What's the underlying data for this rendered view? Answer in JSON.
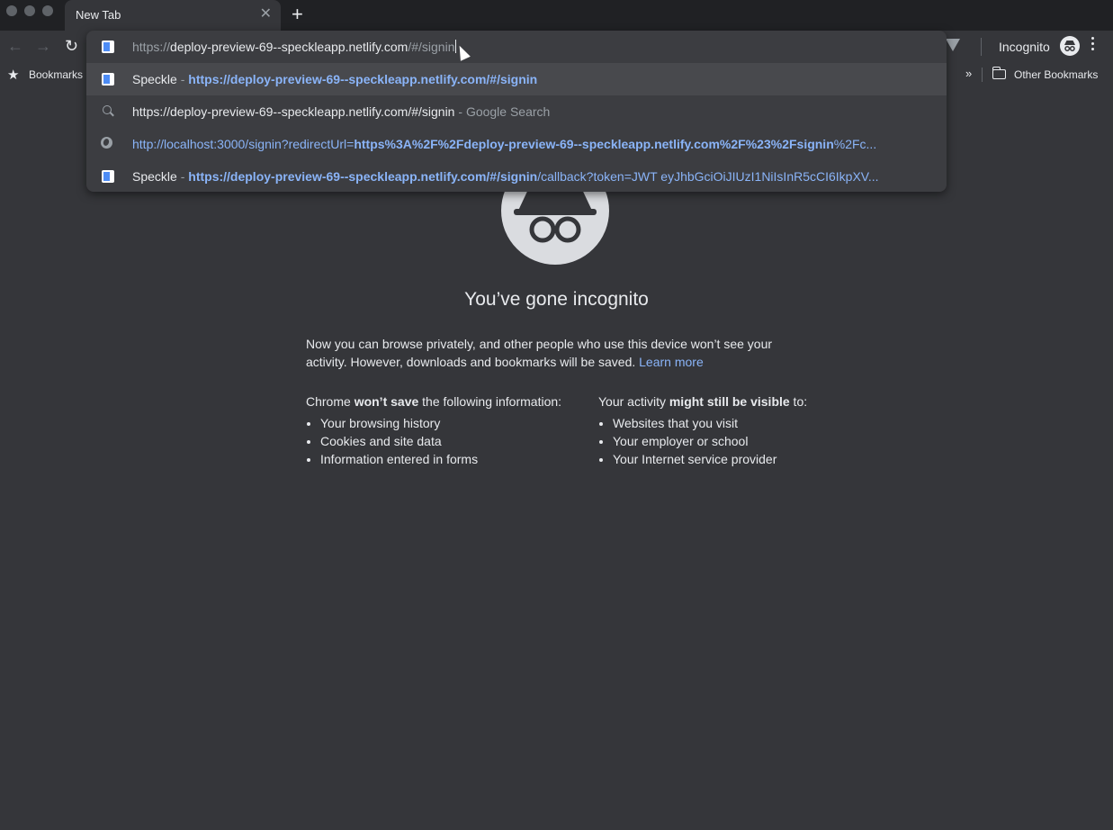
{
  "tab": {
    "title": "New Tab",
    "close_glyph": "✕",
    "new_tab_glyph": "+"
  },
  "toolbar": {
    "back_glyph": "←",
    "forward_glyph": "→",
    "reload_glyph": "↻",
    "profile_label": "Incognito"
  },
  "bookmarks_bar": {
    "label": "Bookmarks",
    "overflow_glyph": "»",
    "other_label": "Other Bookmarks"
  },
  "omnibox": {
    "input": {
      "scheme": "https://",
      "host": "deploy-preview-69--speckleapp.netlify.com",
      "path": "/#/signin"
    },
    "suggestions": [
      {
        "icon": "page-icon",
        "title": "Speckle",
        "separator": " - ",
        "url_bold": "https://deploy-preview-69--speckleapp.netlify.com/#/signin",
        "url_rest": ""
      },
      {
        "icon": "search-icon",
        "query": "https://deploy-preview-69--speckleapp.netlify.com/#/signin",
        "separator": " - ",
        "engine": "Google Search"
      },
      {
        "icon": "globe-icon",
        "url_pre": "http://localhost:3000/signin?redirectUrl=",
        "url_bold": "https%3A%2F%2Fdeploy-preview-69--speckleapp.netlify.com%2F%23%2Fsignin",
        "url_rest": "%2Fc..."
      },
      {
        "icon": "page-icon",
        "title": "Speckle",
        "separator": " - ",
        "url_bold": "https://deploy-preview-69--speckleapp.netlify.com/#/signin",
        "url_rest": "/callback?token=JWT eyJhbGciOiJIUzI1NiIsInR5cCI6IkpXV..."
      }
    ]
  },
  "incognito_page": {
    "title": "You’ve gone incognito",
    "intro_text": "Now you can browse privately, and other people who use this device won’t see your activity. However, downloads and bookmarks will be saved. ",
    "learn_more": "Learn more",
    "left_column": {
      "head_pre": "Chrome ",
      "head_bold": "won’t save",
      "head_post": " the following information:",
      "items": [
        "Your browsing history",
        "Cookies and site data",
        "Information entered in forms"
      ]
    },
    "right_column": {
      "head_pre": "Your activity ",
      "head_bold": "might still be visible",
      "head_post": " to:",
      "items": [
        "Websites that you visit",
        "Your employer or school",
        "Your Internet service provider"
      ]
    }
  },
  "colors": {
    "page_bg": "#35363a",
    "tabstrip_bg": "#202124",
    "dropdown_bg": "#3c3d41",
    "link": "#8ab4f8"
  }
}
